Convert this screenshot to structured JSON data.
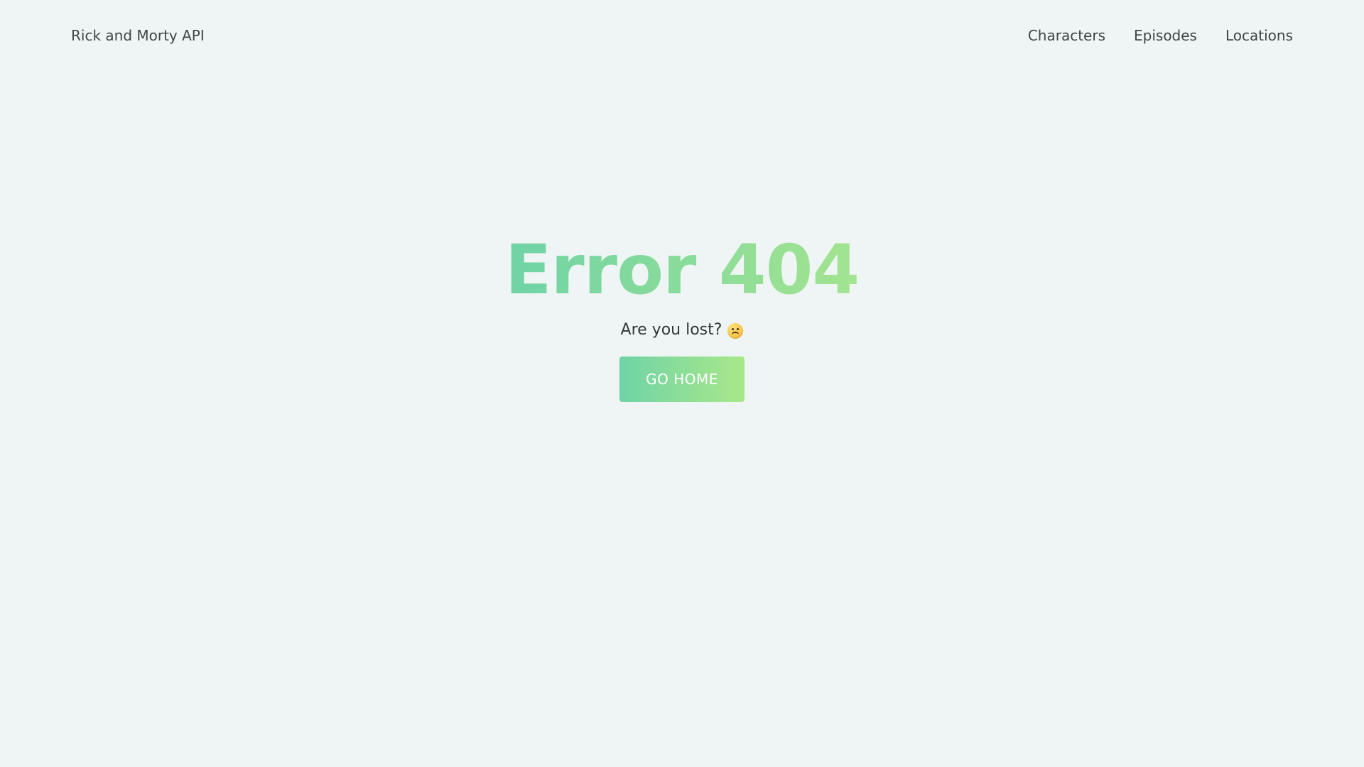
{
  "header": {
    "brand": "Rick and Morty API",
    "nav": {
      "characters": "Characters",
      "episodes": "Episodes",
      "locations": "Locations"
    }
  },
  "error": {
    "title": "Error 404",
    "subtitle": "Are you lost?",
    "emoji_icon": "sad-face-icon",
    "button": "GO HOME"
  },
  "colors": {
    "background": "#eff5f4",
    "gradient_start": "#6fd3a6",
    "gradient_end": "#a9e88a",
    "text": "#2f3938"
  }
}
